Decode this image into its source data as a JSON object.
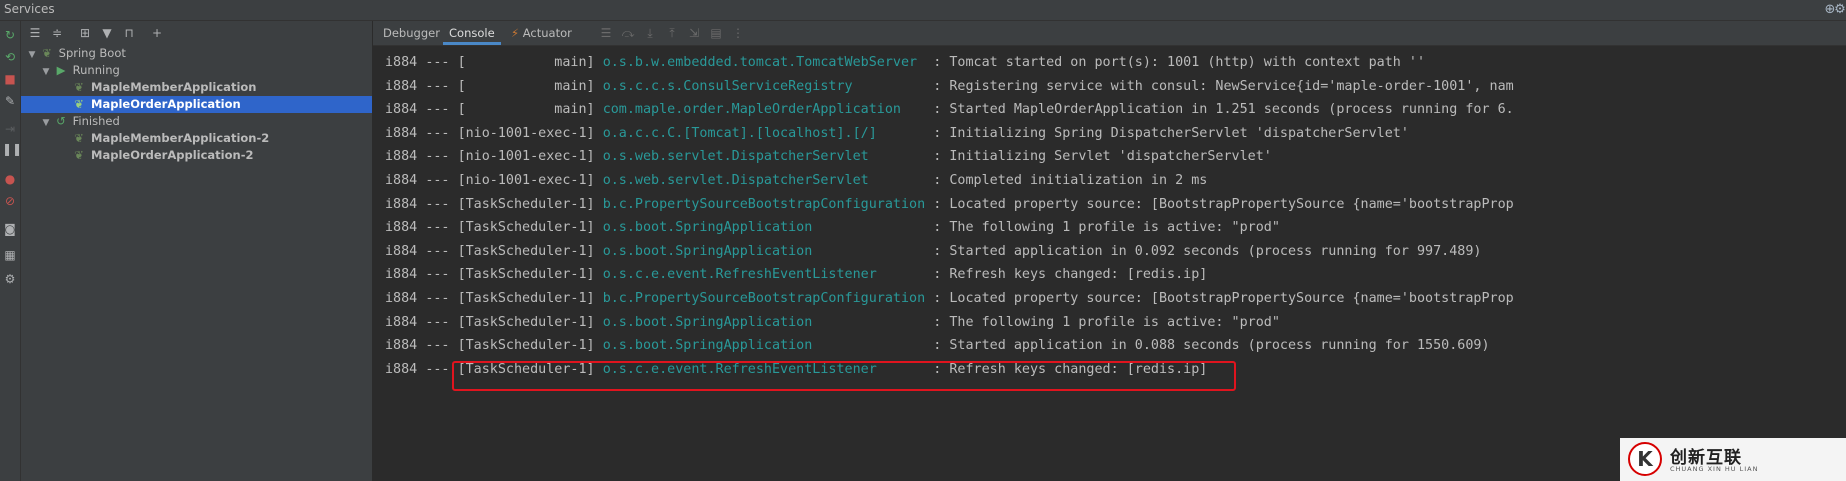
{
  "window": {
    "title": "Services"
  },
  "tree": {
    "root": "Spring Boot",
    "groups": [
      {
        "label": "Running",
        "items": [
          "MapleMemberApplication",
          "MapleOrderApplication"
        ],
        "selected_index": 1
      },
      {
        "label": "Finished",
        "items": [
          "MapleMemberApplication-2",
          "MapleOrderApplication-2"
        ]
      }
    ]
  },
  "tabs": {
    "debugger": "Debugger",
    "console": "Console",
    "actuator": "Actuator"
  },
  "console": {
    "lines": [
      {
        "pid": "i884",
        "sep": "---",
        "thread": "[           main]",
        "logger": "o.s.b.w.embedded.tomcat.TomcatWebServer",
        "message": ": Tomcat started on port(s): 1001 (http) with context path ''"
      },
      {
        "pid": "i884",
        "sep": "---",
        "thread": "[           main]",
        "logger": "o.s.c.c.s.ConsulServiceRegistry",
        "message": ": Registering service with consul: NewService{id='maple-order-1001', nam"
      },
      {
        "pid": "i884",
        "sep": "---",
        "thread": "[           main]",
        "logger": "com.maple.order.MapleOrderApplication",
        "message": ": Started MapleOrderApplication in 1.251 seconds (process running for 6."
      },
      {
        "pid": "i884",
        "sep": "---",
        "thread": "[nio-1001-exec-1]",
        "logger": "o.a.c.c.C.[Tomcat].[localhost].[/]",
        "message": ": Initializing Spring DispatcherServlet 'dispatcherServlet'"
      },
      {
        "pid": "i884",
        "sep": "---",
        "thread": "[nio-1001-exec-1]",
        "logger": "o.s.web.servlet.DispatcherServlet",
        "message": ": Initializing Servlet 'dispatcherServlet'"
      },
      {
        "pid": "i884",
        "sep": "---",
        "thread": "[nio-1001-exec-1]",
        "logger": "o.s.web.servlet.DispatcherServlet",
        "message": ": Completed initialization in 2 ms"
      },
      {
        "pid": "i884",
        "sep": "---",
        "thread": "[TaskScheduler-1]",
        "logger": "b.c.PropertySourceBootstrapConfiguration",
        "message": ": Located property source: [BootstrapPropertySource {name='bootstrapProp"
      },
      {
        "pid": "i884",
        "sep": "---",
        "thread": "[TaskScheduler-1]",
        "logger": "o.s.boot.SpringApplication",
        "message": ": The following 1 profile is active: \"prod\""
      },
      {
        "pid": "i884",
        "sep": "---",
        "thread": "[TaskScheduler-1]",
        "logger": "o.s.boot.SpringApplication",
        "message": ": Started application in 0.092 seconds (process running for 997.489)"
      },
      {
        "pid": "i884",
        "sep": "---",
        "thread": "[TaskScheduler-1]",
        "logger": "o.s.c.e.event.RefreshEventListener",
        "message": ": Refresh keys changed: [redis.ip]"
      },
      {
        "pid": "i884",
        "sep": "---",
        "thread": "[TaskScheduler-1]",
        "logger": "b.c.PropertySourceBootstrapConfiguration",
        "message": ": Located property source: [BootstrapPropertySource {name='bootstrapProp"
      },
      {
        "pid": "i884",
        "sep": "---",
        "thread": "[TaskScheduler-1]",
        "logger": "o.s.boot.SpringApplication",
        "message": ": The following 1 profile is active: \"prod\""
      },
      {
        "pid": "i884",
        "sep": "---",
        "thread": "[TaskScheduler-1]",
        "logger": "o.s.boot.SpringApplication",
        "message": ": Started application in 0.088 seconds (process running for 1550.609)"
      },
      {
        "pid": "i884",
        "sep": "---",
        "thread": "[TaskScheduler-1]",
        "logger": "o.s.c.e.event.RefreshEventListener",
        "message": ": Refresh keys changed: [redis.ip]"
      }
    ],
    "highlighted_line_index": 13
  },
  "watermark": {
    "logo": "K",
    "text": "创新互联",
    "sub": "CHUANG XIN HU LIAN"
  },
  "colors": {
    "background": "#2b2b2b",
    "panel": "#3c3f41",
    "selection": "#2f65ca",
    "logger": "#299999",
    "text": "#bbbbbb",
    "highlight_border": "#e0141e"
  },
  "icons": {
    "settings": "gear-icon",
    "add": "add-icon",
    "expand_all": "expand-all-icon",
    "collapse_all": "collapse-all-icon",
    "group": "group-by-icon",
    "filter": "filter-icon",
    "new_window": "open-in-window-icon",
    "run": "rerun-icon",
    "stop": "stop-icon",
    "pause": "pause-icon",
    "camera": "camera-icon",
    "layout": "layout-icon",
    "spring_boot": "spring-boot-leaf-icon"
  }
}
